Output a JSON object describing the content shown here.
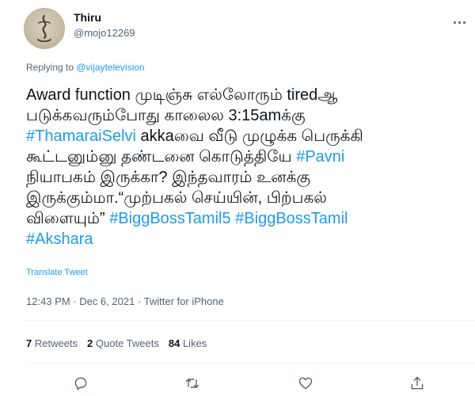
{
  "author": {
    "display_name": "Thiru",
    "handle": "@mojo12269"
  },
  "replying": {
    "prefix": "Replying to ",
    "mention": "@vijaytelevision"
  },
  "tweet": {
    "line1": "Award function முடிஞ்சு எல்லோரும் tiredஆ",
    "line2": "படுக்கவரும்போது காலைல 3:15amக்கு",
    "line3_tag": "#ThamaraiSelvi",
    "line3_text": " akkaவை வீடு முழுக்க பெருக்கி",
    "line4_text": "கூட்டனும்னு தண்டனை கொடுத்தியே ",
    "line4_tag": "#Pavni",
    "line5": "நியாபகம் இருக்கா? இந்தவாரம் உனக்கு",
    "line6": "இருக்கும்மா.“முற்பகல் செய்யின், பிற்பகல்",
    "line7_text": "விளையும்” ",
    "line7_tag1": "#BiggBossTamil5",
    "line7_tag2": "#BiggBossTamil",
    "line8_tag": "#Akshara"
  },
  "translate_label": "Translate Tweet",
  "meta": {
    "time": "12:43 PM · Dec 6, 2021",
    "separator": " · ",
    "source": "Twitter for iPhone"
  },
  "stats": {
    "retweets_count": "7",
    "retweets_label": " Retweets",
    "quotes_count": "2",
    "quotes_label": " Quote Tweets",
    "likes_count": "84",
    "likes_label": " Likes"
  },
  "icons": {
    "reply": "reply-icon",
    "retweet": "retweet-icon",
    "like": "heart-icon",
    "share": "share-icon",
    "more": "more-icon"
  },
  "colors": {
    "accent": "#1d9bf0",
    "text": "#0f1419",
    "muted": "#536471",
    "divider": "#eff3f4"
  }
}
